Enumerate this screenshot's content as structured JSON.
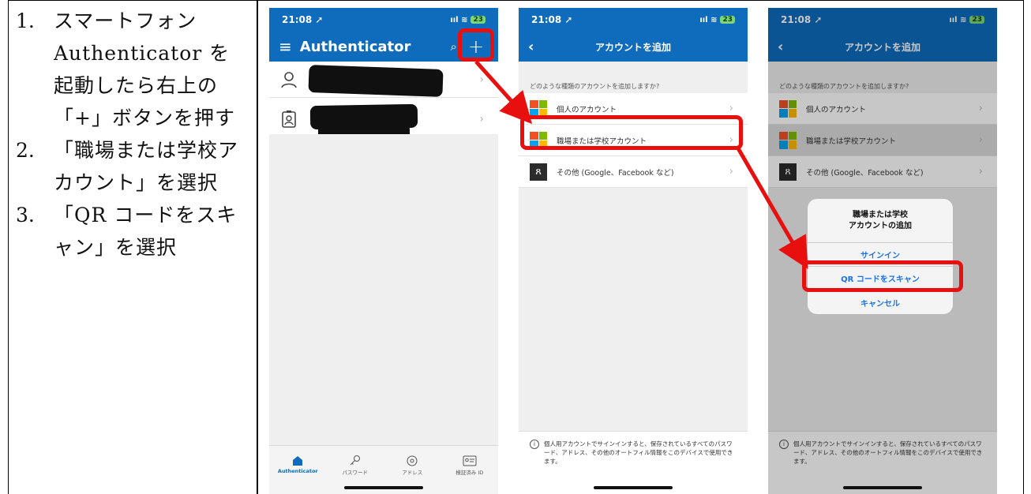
{
  "instructions": {
    "steps": [
      {
        "num": "1.",
        "text": "スマートフォン Authenticator を起動したら右上の「+」ボタンを押す"
      },
      {
        "num": "2.",
        "text": "「職場または学校アカウント」を選択"
      },
      {
        "num": "3.",
        "text": "「QR コードをスキャン」を選択"
      }
    ]
  },
  "status_bar": {
    "time": "21:08 ➚",
    "battery": "23"
  },
  "screen1": {
    "title": "Authenticator",
    "tabs": [
      "Authenticator",
      "パスワード",
      "アドレス",
      "検証済み ID"
    ]
  },
  "screen2": {
    "title": "アカウントを追加",
    "question": "どのような種類のアカウントを追加しますか?",
    "options": [
      "個人のアカウント",
      "職場または学校アカウント",
      "その他 (Google、Facebook など)"
    ],
    "footer": "個人用アカウントでサインインすると、保存されているすべてのパスワード、アドレス、その他のオートフィル情報をこのデバイスで使用できます。"
  },
  "screen3": {
    "dialog_title": "職場または学校\nアカウントの追加",
    "dialog_title_line1": "職場または学校",
    "dialog_title_line2": "アカウントの追加",
    "sign_in": "サインイン",
    "scan_qr": "QR コードをスキャン",
    "cancel": "キャンセル"
  },
  "colors": {
    "brand": "#0f6cbd",
    "highlight": "#e8100f",
    "link": "#1a73e8"
  }
}
